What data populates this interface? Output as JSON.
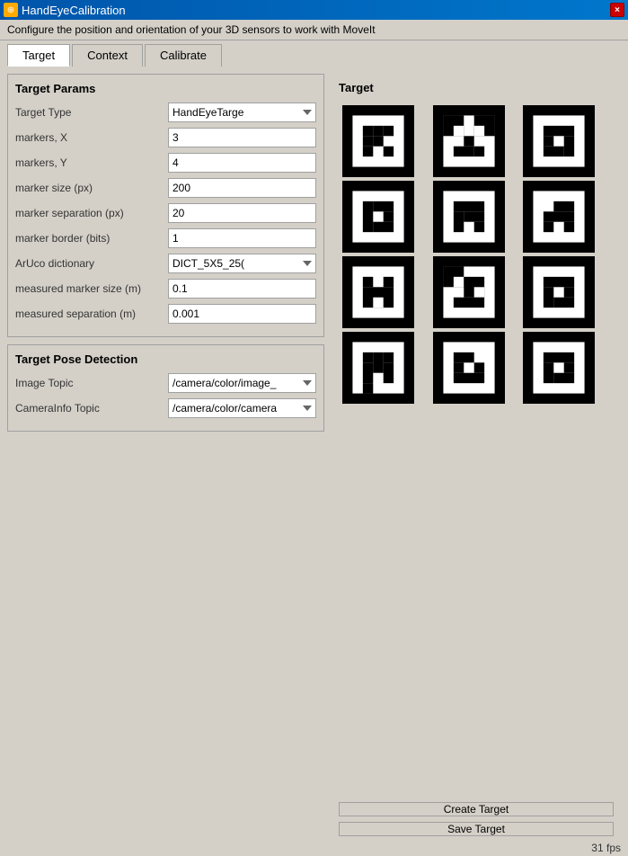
{
  "titleBar": {
    "title": "HandEyeCalibration",
    "closeLabel": "×"
  },
  "subtitle": "Configure the position and orientation of your 3D sensors to work with MoveIt",
  "tabs": [
    {
      "label": "Target",
      "active": true
    },
    {
      "label": "Context",
      "active": false
    },
    {
      "label": "Calibrate",
      "active": false
    }
  ],
  "targetParams": {
    "sectionTitle": "Target Params",
    "fields": [
      {
        "label": "Target Type",
        "type": "select",
        "value": "HandEyeTarge"
      },
      {
        "label": "markers, X",
        "type": "input",
        "value": "3"
      },
      {
        "label": "markers, Y",
        "type": "input",
        "value": "4"
      },
      {
        "label": "marker size (px)",
        "type": "input",
        "value": "200"
      },
      {
        "label": "marker separation (px)",
        "type": "input",
        "value": "20"
      },
      {
        "label": "marker border (bits)",
        "type": "input",
        "value": "1"
      },
      {
        "label": "ArUco dictionary",
        "type": "select",
        "value": "DICT_5X5_25("
      },
      {
        "label": "measured marker size (m)",
        "type": "input",
        "value": "0.1"
      },
      {
        "label": "measured separation (m)",
        "type": "input",
        "value": "0.001"
      }
    ]
  },
  "targetPoseDetection": {
    "sectionTitle": "Target Pose Detection",
    "fields": [
      {
        "label": "Image Topic",
        "type": "select",
        "value": "/camera/color/image_"
      },
      {
        "label": "CameraInfo Topic",
        "type": "select",
        "value": "/camera/color/camera"
      }
    ]
  },
  "rightPanel": {
    "label": "Target"
  },
  "buttons": {
    "createTarget": "Create Target",
    "saveTarget": "Save Target"
  },
  "statusBar": {
    "fps": "31 fps"
  }
}
